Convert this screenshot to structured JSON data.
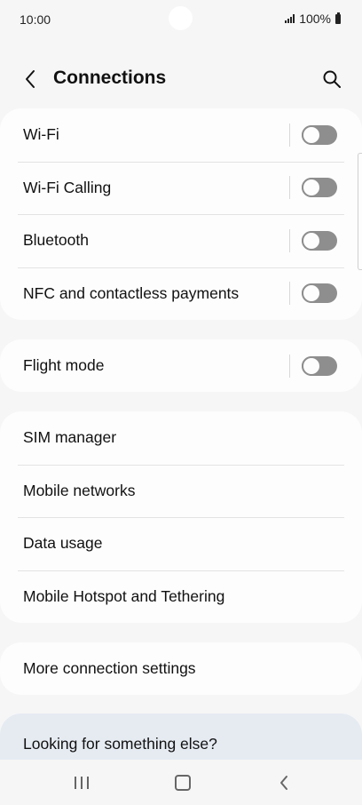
{
  "status_bar": {
    "time": "10:00",
    "battery": "100%",
    "icons": [
      "signal-icon",
      "battery-icon"
    ]
  },
  "header": {
    "title": "Connections",
    "back_icon": "chevron-left-icon",
    "search_icon": "search-icon"
  },
  "toggle_settings": [
    {
      "label": "Wi-Fi",
      "enabled": false
    },
    {
      "label": "Wi-Fi Calling",
      "enabled": false
    },
    {
      "label": "Bluetooth",
      "enabled": false
    },
    {
      "label": "NFC and contactless payments",
      "enabled": false
    }
  ],
  "flight_mode": {
    "label": "Flight mode",
    "enabled": false
  },
  "links": [
    {
      "label": "SIM manager"
    },
    {
      "label": "Mobile networks"
    },
    {
      "label": "Data usage"
    },
    {
      "label": "Mobile Hotspot and Tethering"
    }
  ],
  "more_settings": {
    "label": "More connection settings"
  },
  "suggestion": {
    "label": "Looking for something else?"
  },
  "nav_bar": {
    "icons": [
      "recents-icon",
      "home-icon",
      "back-icon"
    ]
  },
  "colors": {
    "background": "#f6f6f6",
    "card": "#fdfdfd",
    "toggle_off": "#8e8e8e",
    "suggestion_bg": "#e6ebf2"
  }
}
